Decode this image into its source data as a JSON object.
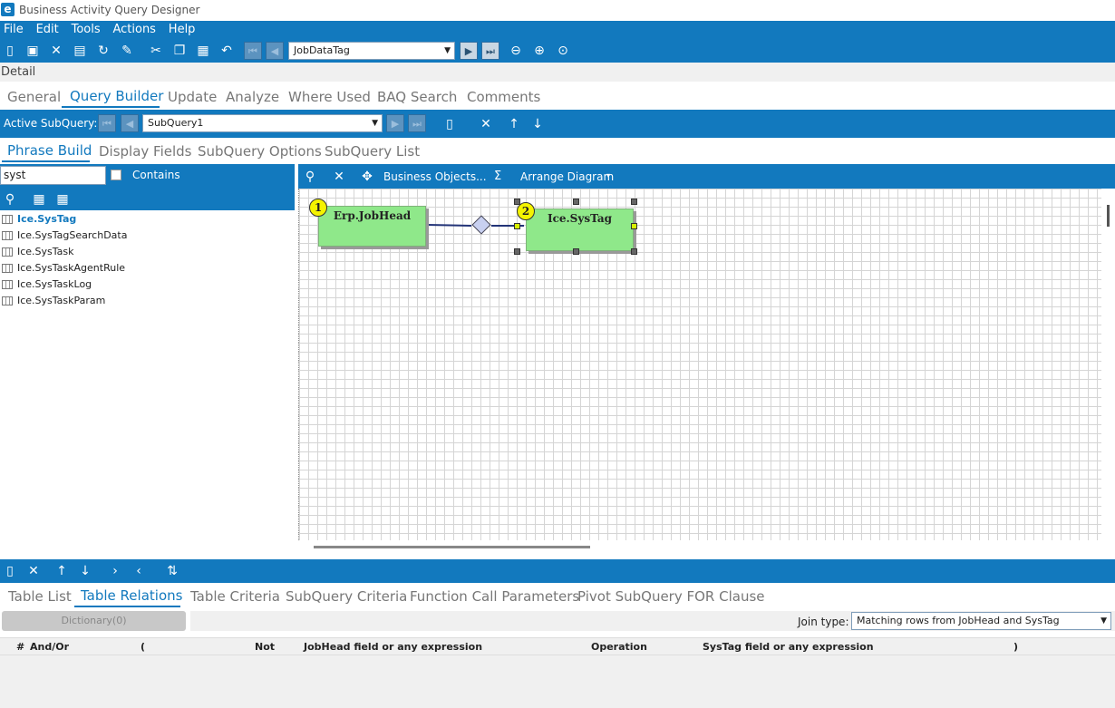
{
  "window": {
    "title": "Business Activity Query Designer",
    "logo_letter": "e"
  },
  "menu": [
    "File",
    "Edit",
    "Tools",
    "Actions",
    "Help"
  ],
  "toolbar": {
    "query_combo": "JobDataTag"
  },
  "detail_label": "Detail",
  "main_tabs": [
    "General",
    "Query Builder",
    "Update",
    "Analyze",
    "Where Used",
    "BAQ Search",
    "Comments"
  ],
  "active_main_tab": "Query Builder",
  "subquery": {
    "label": "Active SubQuery:",
    "value": "SubQuery1"
  },
  "sub_tabs": [
    "Phrase Build",
    "Display Fields",
    "SubQuery Options",
    "SubQuery List"
  ],
  "active_sub_tab": "Phrase Build",
  "left": {
    "search_value": "syst",
    "contains_label": "Contains",
    "contains_checked": false,
    "items": [
      "Ice.SysTag",
      "Ice.SysTagSearchData",
      "Ice.SysTask",
      "Ice.SysTaskAgentRule",
      "Ice.SysTaskLog",
      "Ice.SysTaskParam"
    ],
    "selected": "Ice.SysTag"
  },
  "diagram": {
    "business_objects_label": "Business Objects...",
    "sigma_label": "Σ",
    "arrange_label": "Arrange Diagram",
    "nodes": [
      {
        "badge": "1",
        "title": "Erp.JobHead"
      },
      {
        "badge": "2",
        "title": "Ice.SysTag"
      }
    ]
  },
  "bottom_tabs": [
    "Table List",
    "Table Relations",
    "Table Criteria",
    "SubQuery Criteria",
    "Function Call Parameters",
    "Pivot SubQuery FOR Clause"
  ],
  "active_bottom_tab": "Table Relations",
  "relations": {
    "dictionary_label": "Dictionary(0)",
    "join_type_label": "Join type:",
    "join_type_value": "Matching rows from JobHead and SysTag",
    "columns": [
      "#",
      "And/Or",
      "(",
      "Not",
      "JobHead field or any expression",
      "Operation",
      "SysTag field or any expression",
      ")"
    ]
  },
  "colors": {
    "accent": "#1279be",
    "node_fill": "#8fe88a",
    "badge": "#f4f300"
  }
}
